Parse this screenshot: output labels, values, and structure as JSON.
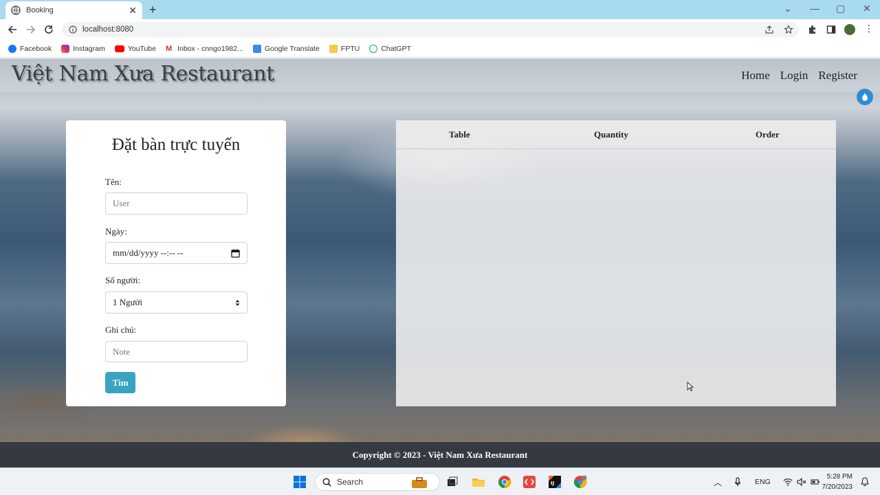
{
  "browser": {
    "tab_title": "Booking",
    "url": "localhost:8080",
    "bookmarks": [
      "Facebook",
      "Instagram",
      "YouTube",
      "Inbox - cnngo1982...",
      "Google Translate",
      "FPTU",
      "ChatGPT"
    ]
  },
  "site": {
    "brand": "Việt Nam Xưa Restaurant",
    "nav": [
      "Home",
      "Login",
      "Register"
    ]
  },
  "booking_form": {
    "title": "Đặt bàn trực tuyến",
    "name_label": "Tên:",
    "name_placeholder": "User",
    "date_label": "Ngày:",
    "date_value": "mm/dd/yyyy --:-- --",
    "people_label": "Số người:",
    "people_value": "1 Người",
    "note_label": "Ghi chú:",
    "note_placeholder": "Note",
    "submit_label": "Tìm"
  },
  "results_table": {
    "columns": [
      "Table",
      "Quantity",
      "Order"
    ],
    "rows": []
  },
  "footer": {
    "copyright": "Copyright © 2023 - Việt Nam Xưa Restaurant"
  },
  "taskbar": {
    "search_label": "Search",
    "language": "ENG",
    "time": "5:28 PM",
    "date": "7/20/2023"
  }
}
